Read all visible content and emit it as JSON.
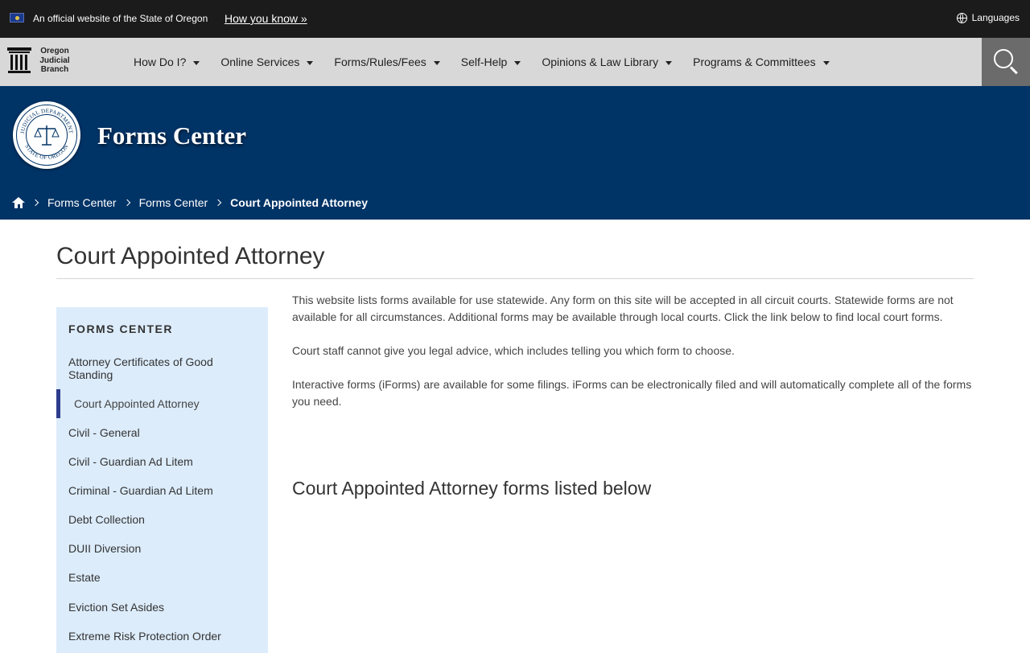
{
  "official_bar": {
    "text": "An official website of the State of Oregon",
    "how_link": "How you know »",
    "languages": "Languages"
  },
  "logo": {
    "line1": "Oregon",
    "line2": "Judicial",
    "line3": "Branch"
  },
  "nav": {
    "items": [
      {
        "label": "How Do I?"
      },
      {
        "label": "Online Services"
      },
      {
        "label": "Forms/Rules/Fees"
      },
      {
        "label": "Self-Help"
      },
      {
        "label": "Opinions & Law Library"
      },
      {
        "label": "Programs & Committees"
      }
    ]
  },
  "banner": {
    "title": "Forms Center",
    "seal_text_top": "JUDICIAL DEPARTMENT",
    "seal_text_bottom": "STATE OF OREGON"
  },
  "breadcrumb": {
    "items": [
      "Forms Center",
      "Forms Center"
    ],
    "current": "Court Appointed Attorney"
  },
  "page": {
    "title": "Court Appointed Attorney",
    "paragraphs": [
      "This website lists forms available for use statewide. Any form on this site will be accepted in all circuit courts. Statewide forms are not available for all circumstances.  Additional forms may be available through local courts.  Click the link below to find local court forms.",
      "Court staff cannot give you legal advice, which includes telling you which form to choose.",
      "Interactive forms (iForms) are available for some filings. iForms can be electronically filed and will automatically complete all of the forms you need."
    ],
    "forms_heading": "Court Appointed Attorney forms listed below"
  },
  "sidebar": {
    "heading": "FORMS CENTER",
    "items": [
      {
        "label": "Attorney Certificates of Good Standing"
      },
      {
        "label": "Court Appointed Attorney",
        "active": true
      },
      {
        "label": "Civil - General"
      },
      {
        "label": "Civil - Guardian Ad Litem"
      },
      {
        "label": "Criminal - Guardian Ad Litem"
      },
      {
        "label": "Debt Collection"
      },
      {
        "label": "DUII Diversion"
      },
      {
        "label": "Estate"
      },
      {
        "label": "Eviction Set Asides"
      },
      {
        "label": "Extreme Risk Protection Order"
      }
    ]
  },
  "colors": {
    "official_bar": "#1b1b1b",
    "nav_bg": "#d8d8d8",
    "banner": "#003366",
    "sidebar_bg": "#dcecfb",
    "active_marker": "#2d3c8c",
    "search_bg": "#6b6b6b"
  },
  "icons": {
    "flag": "oregon-flag-icon",
    "globe": "globe-icon",
    "logo": "columns-logo-icon",
    "search": "search-icon",
    "seal": "judicial-seal-icon",
    "home": "home-icon",
    "chevron": "chevron-right-icon",
    "caret": "caret-down-icon"
  }
}
